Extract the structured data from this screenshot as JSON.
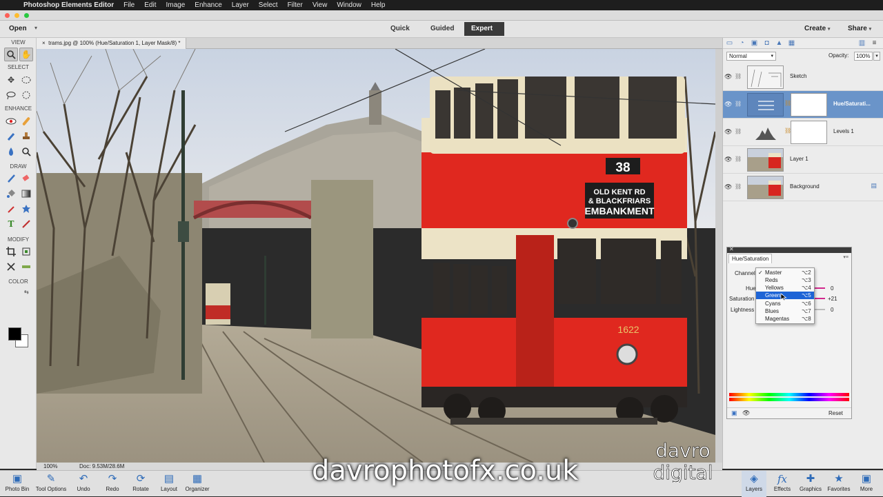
{
  "menubar": {
    "app_name": "Photoshop Elements Editor",
    "items": [
      "File",
      "Edit",
      "Image",
      "Enhance",
      "Layer",
      "Select",
      "Filter",
      "View",
      "Window",
      "Help"
    ]
  },
  "modebar": {
    "open_label": "Open",
    "modes": [
      "Quick",
      "Guided",
      "Expert"
    ],
    "active_mode": "Expert",
    "create_label": "Create",
    "share_label": "Share"
  },
  "toolbox": {
    "sections": [
      "VIEW",
      "SELECT",
      "ENHANCE",
      "DRAW",
      "MODIFY",
      "COLOR"
    ]
  },
  "document": {
    "tab_title": "trams.jpg @ 100% (Hue/Saturation 1, Layer Mask/8) *",
    "zoom": "100%",
    "doc_size": "Doc: 9.53M/28.6M"
  },
  "canvas_text": {
    "route_number": "38",
    "destination_line1": "OLD KENT RD",
    "destination_line2": "& BLACKFRIARS",
    "destination_line3": "EMBANKMENT",
    "fleet_number": "1622"
  },
  "layers_panel": {
    "blend_mode": "Normal",
    "opacity_label": "Opacity:",
    "opacity_value": "100%",
    "layers": [
      {
        "name": "Sketch",
        "selected": false
      },
      {
        "name": "Hue/Saturati...",
        "selected": true
      },
      {
        "name": "Levels 1",
        "selected": false
      },
      {
        "name": "Layer 1",
        "selected": false
      },
      {
        "name": "Background",
        "selected": false
      }
    ]
  },
  "hue_saturation": {
    "tab": "Hue/Saturation",
    "channel_label": "Channel",
    "hue_label": "Hue",
    "saturation_label": "Saturation",
    "lightness_label": "Lightness",
    "hue_value": "0",
    "saturation_value": "+21",
    "lightness_value": "0",
    "reset_label": "Reset",
    "channel_options": [
      {
        "label": "Master",
        "shortcut": "⌥2",
        "checked": true,
        "highlighted": false
      },
      {
        "label": "Reds",
        "shortcut": "⌥3",
        "checked": false,
        "highlighted": false
      },
      {
        "label": "Yellows",
        "shortcut": "⌥4",
        "checked": false,
        "highlighted": false
      },
      {
        "label": "Greens",
        "shortcut": "⌥5",
        "checked": false,
        "highlighted": true
      },
      {
        "label": "Cyans",
        "shortcut": "⌥6",
        "checked": false,
        "highlighted": false
      },
      {
        "label": "Blues",
        "shortcut": "⌥7",
        "checked": false,
        "highlighted": false
      },
      {
        "label": "Magentas",
        "shortcut": "⌥8",
        "checked": false,
        "highlighted": false
      }
    ]
  },
  "taskbar": {
    "left": [
      "Photo Bin",
      "Tool Options",
      "Undo",
      "Redo",
      "Rotate",
      "Layout",
      "Organizer"
    ],
    "right": [
      "Layers",
      "Effects",
      "Graphics",
      "Favorites",
      "More"
    ]
  },
  "overlay": {
    "watermark": "davrophotofx.co.uk",
    "logo_line1": "davro",
    "logo_line2": "digital"
  },
  "colors": {
    "accent": "#2e6bb8",
    "selected_layer": "#6a94c9",
    "tram_red": "#e02a22",
    "menu_highlight": "#1d64d6"
  }
}
